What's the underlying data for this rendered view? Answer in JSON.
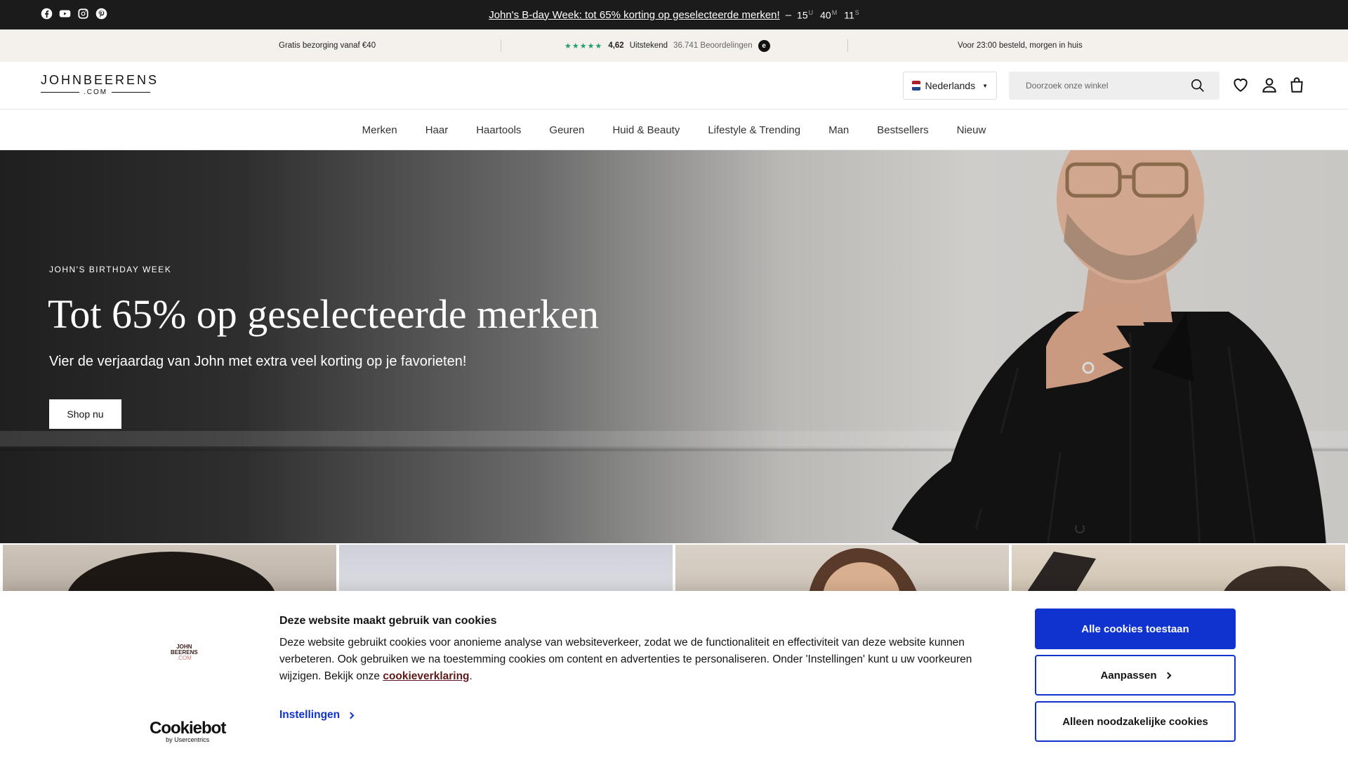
{
  "announcement": {
    "socials": [
      "facebook-icon",
      "youtube-icon",
      "instagram-icon",
      "pinterest-icon"
    ],
    "promo_text": "John's B-day Week: tot 65% korting op geselecteerde merken!",
    "dash": "–",
    "timer": {
      "hours": "15",
      "hours_unit": "U",
      "minutes": "40",
      "minutes_unit": "M",
      "seconds": "11",
      "seconds_unit": "S"
    }
  },
  "usp": {
    "shipping": "Gratis bezorging vanaf €40",
    "rating_stars": "★★★★★",
    "rating_score": "4,62",
    "rating_label": "Uitstekend",
    "rating_count": "36.741 Beoordelingen",
    "rating_logo": "e",
    "delivery": "Voor 23:00 besteld, morgen in huis"
  },
  "header": {
    "logo_main": "JOHNBEERENS",
    "logo_sub": ".COM",
    "language": "Nederlands",
    "search_placeholder": "Doorzoek onze winkel"
  },
  "nav": {
    "items": [
      "Merken",
      "Haar",
      "Haartools",
      "Geuren",
      "Huid & Beauty",
      "Lifestyle & Trending",
      "Man",
      "Bestsellers",
      "Nieuw"
    ]
  },
  "hero": {
    "kicker": "JOHN'S BIRTHDAY WEEK",
    "title": "Tot 65% op geselecteerde merken",
    "subtitle": "Vier de verjaardag van John met extra veel korting op je favorieten!",
    "cta": "Shop nu"
  },
  "cookie": {
    "logo_line1": "JOHN",
    "logo_line2": "BEERENS",
    "logo_line3": ".COM",
    "title": "Deze website maakt gebruik van cookies",
    "body": "Deze website gebruikt cookies voor anonieme analyse van websiteverkeer, zodat we de functionaliteit en effectiviteit van deze website kunnen verbeteren. Ook gebruiken we na toestemming cookies om content en advertenties te personaliseren. Onder 'Instellingen' kunt u uw voorkeuren wijzigen. Bekijk onze ",
    "link": "cookieverklaring",
    "period": ".",
    "settings": "Instellingen",
    "brand": "Cookiebot",
    "brand_sub": "by Usercentrics",
    "btn_allow": "Alle cookies toestaan",
    "btn_customize": "Aanpassen",
    "btn_necessary": "Alleen noodzakelijke cookies"
  },
  "colors": {
    "accent_blue": "#1032cf",
    "announcement_bg": "#1b1b1b",
    "usp_bg": "#f4f1ec",
    "trustpilot_green": "#22a06b"
  }
}
